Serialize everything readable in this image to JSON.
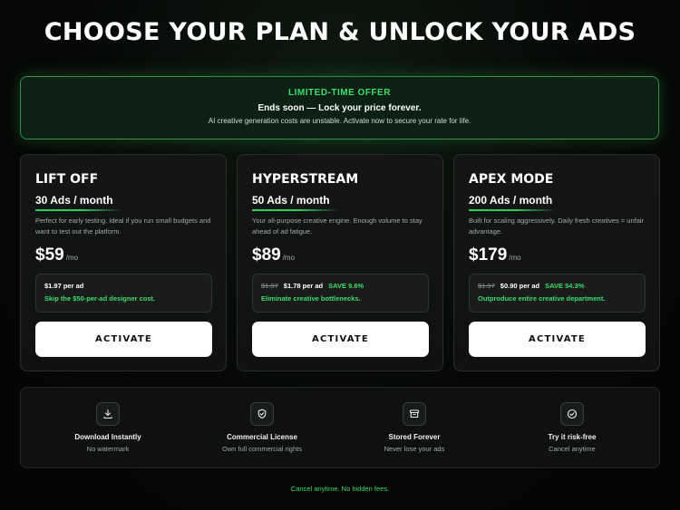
{
  "page": {
    "title": "CHOOSE YOUR PLAN & UNLOCK YOUR ADS",
    "footer": "Cancel anytime. No hidden fees."
  },
  "offer": {
    "tag": "LIMITED-TIME OFFER",
    "headline": "Ends soon — Lock your price forever.",
    "subtext": "AI creative generation costs are unstable. Activate now to secure your rate for life."
  },
  "plans": [
    {
      "name": "LIFT OFF",
      "ads": "30 Ads / month",
      "description": "Perfect for early testing. Ideal if you run small budgets and want to test out the platform.",
      "price": "$59",
      "unit": "/mo",
      "old_per_ad": "",
      "per_ad": "$1.97 per ad",
      "save": "",
      "note": "Skip the $50-per-ad designer cost.",
      "button": "ACTIVATE"
    },
    {
      "name": "HYPERSTREAM",
      "ads": "50 Ads / month",
      "description": "Your all-purpose creative engine. Enough volume to stay ahead of ad fatigue.",
      "price": "$89",
      "unit": "/mo",
      "old_per_ad": "$1.97",
      "per_ad": "$1.78 per ad",
      "save": "SAVE 9.6%",
      "note": "Eliminate creative bottlenecks.",
      "button": "ACTIVATE"
    },
    {
      "name": "APEX MODE",
      "ads": "200 Ads / month",
      "description": "Built for scaling aggressively. Daily fresh creatives = unfair advantage.",
      "price": "$179",
      "unit": "/mo",
      "old_per_ad": "$1.97",
      "per_ad": "$0.90 per ad",
      "save": "SAVE 54.3%",
      "note": "Outproduce entire creative department.",
      "button": "ACTIVATE"
    }
  ],
  "features": [
    {
      "icon": "download-icon",
      "title": "Download Instantly",
      "subtitle": "No watermark"
    },
    {
      "icon": "shield-check-icon",
      "title": "Commercial License",
      "subtitle": "Own full commercial rights"
    },
    {
      "icon": "archive-icon",
      "title": "Stored Forever",
      "subtitle": "Never lose your ads"
    },
    {
      "icon": "check-circle-icon",
      "title": "Try it risk-free",
      "subtitle": "Cancel anytime"
    }
  ],
  "colors": {
    "accent": "#3ddc6c",
    "background": "#060806",
    "card": "#141615",
    "offer_border": "#2e8f45"
  }
}
